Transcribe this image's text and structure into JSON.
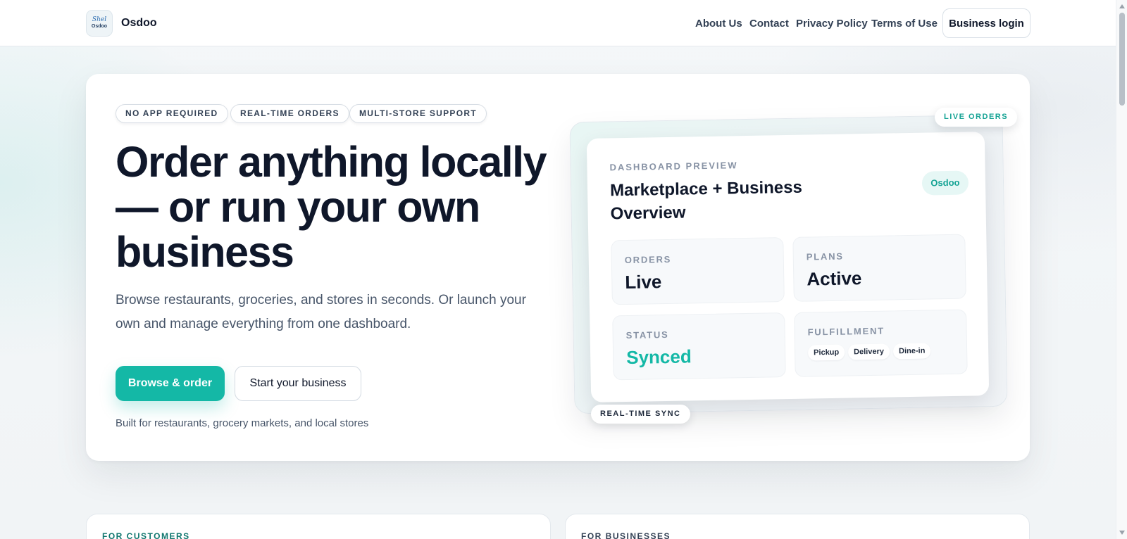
{
  "nav": {
    "logo_script": "Shel",
    "logo_small": "Osdoo",
    "brand": "Osdoo",
    "links": [
      "About Us",
      "Contact",
      "Privacy Policy",
      "Terms of Use"
    ],
    "login": "Business login"
  },
  "hero": {
    "tags": [
      "NO APP REQUIRED",
      "REAL-TIME ORDERS",
      "MULTI-STORE SUPPORT"
    ],
    "headline": "Order anything locally — or run your own business",
    "subtext": "Browse restaurants, groceries, and stores in seconds. Or launch your own and manage everything from one dashboard.",
    "primary_cta": "Browse & order",
    "secondary_cta": "Start your business",
    "built_for": "Built for restaurants, grocery markets, and local stores"
  },
  "dashboard": {
    "live_pill": "LIVE ORDERS",
    "sync_pill": "REAL-TIME SYNC",
    "eyebrow": "DASHBOARD PREVIEW",
    "title": "Marketplace + Business Overview",
    "badge": "Osdoo",
    "tiles": {
      "orders": {
        "label": "ORDERS",
        "value": "Live"
      },
      "plans": {
        "label": "PLANS",
        "value": "Active"
      },
      "status": {
        "label": "STATUS",
        "value": "Synced"
      },
      "fulfillment": {
        "label": "FULFILLMENT",
        "chips": [
          "Pickup",
          "Delivery",
          "Dine-in"
        ]
      }
    }
  },
  "sections": {
    "customers": "FOR CUSTOMERS",
    "businesses": "FOR BUSINESSES"
  },
  "colors": {
    "accent": "#14b8a6",
    "heading": "#0f172a",
    "body": "#475569",
    "muted": "#8893a5"
  },
  "icons": {
    "logo": "osdoo-logo-icon"
  }
}
